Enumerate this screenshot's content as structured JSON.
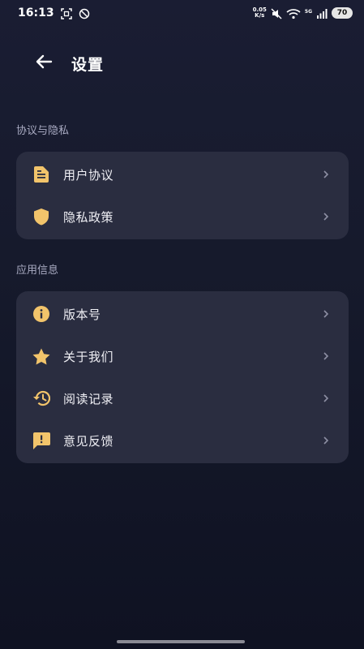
{
  "status_bar": {
    "time": "16:13",
    "net_speed_value": "0.05",
    "net_speed_unit": "K/s",
    "signal_label": "5G",
    "battery": "70"
  },
  "header": {
    "title": "设置"
  },
  "sections": [
    {
      "label": "协议与隐私",
      "items": [
        {
          "label": "用户协议",
          "icon": "document-icon"
        },
        {
          "label": "隐私政策",
          "icon": "shield-icon"
        }
      ]
    },
    {
      "label": "应用信息",
      "items": [
        {
          "label": "版本号",
          "icon": "info-icon"
        },
        {
          "label": "关于我们",
          "icon": "star-icon"
        },
        {
          "label": "阅读记录",
          "icon": "history-icon"
        },
        {
          "label": "意见反馈",
          "icon": "feedback-icon"
        }
      ]
    }
  ],
  "colors": {
    "accent": "#f2c46b",
    "card_bg": "#2a2d40",
    "section_label": "#a9abc2"
  }
}
